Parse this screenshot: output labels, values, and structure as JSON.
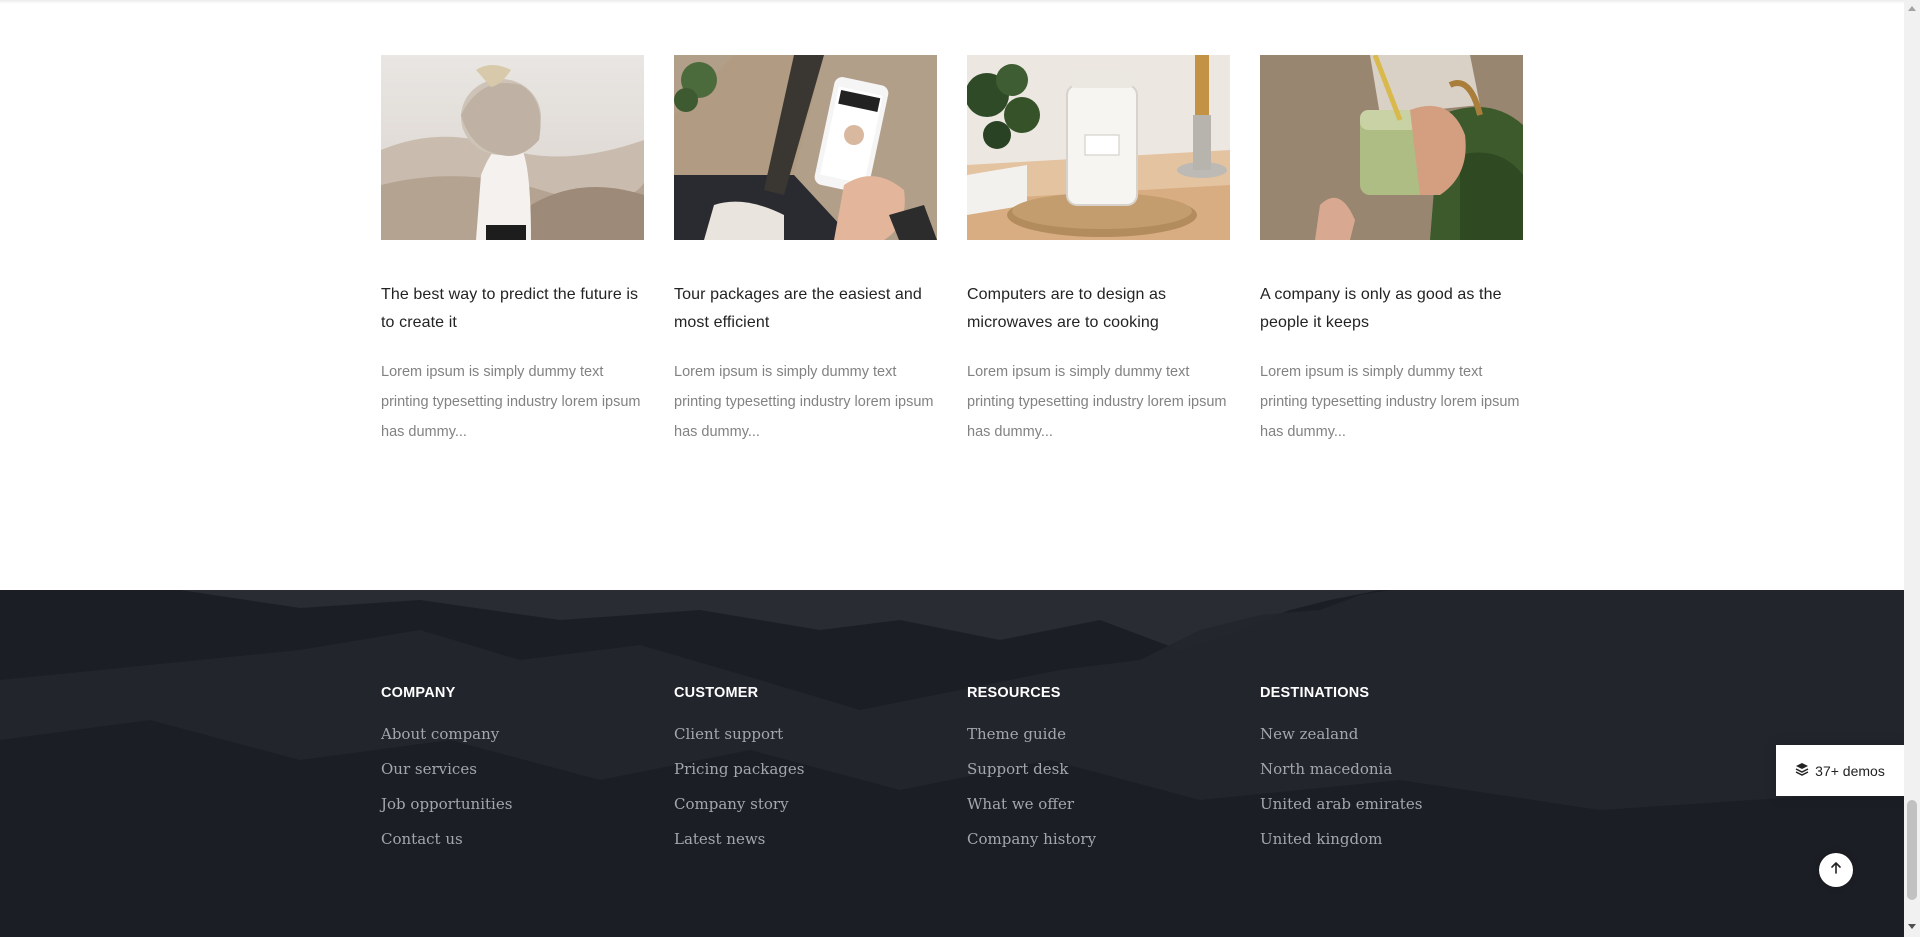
{
  "blog": {
    "posts": [
      {
        "image": "woman-desert-sweater-photo",
        "title": "The best way to predict the future is to create it",
        "excerpt": "Lorem ipsum is simply dummy text printing typesetting industry lorem ipsum has dummy..."
      },
      {
        "image": "phone-in-hand-photo",
        "title": "Tour packages are the easiest and most efficient",
        "excerpt": "Lorem ipsum is simply dummy text printing typesetting industry lorem ipsum has dummy..."
      },
      {
        "image": "candle-jar-plant-photo",
        "title": "Computers are to design as microwaves are to cooking",
        "excerpt": "Lorem ipsum is simply dummy text printing typesetting industry lorem ipsum has dummy..."
      },
      {
        "image": "green-smoothie-photo",
        "title": "A company is only as good as the people it keeps",
        "excerpt": "Lorem ipsum is simply dummy text printing typesetting industry lorem ipsum has dummy..."
      }
    ]
  },
  "footer": {
    "columns": [
      {
        "heading": "Company",
        "links": [
          "About company",
          "Our services",
          "Job opportunities",
          "Contact us"
        ]
      },
      {
        "heading": "Customer",
        "links": [
          "Client support",
          "Pricing packages",
          "Company story",
          "Latest news"
        ]
      },
      {
        "heading": "Resources",
        "links": [
          "Theme guide",
          "Support desk",
          "What we offer",
          "Company history"
        ]
      },
      {
        "heading": "Destinations",
        "links": [
          "New zealand",
          "North macedonia",
          "United arab emirates",
          "United kingdom"
        ]
      }
    ]
  },
  "widgets": {
    "demos_label": "37+ demos",
    "demos_icon": "layers-icon",
    "scroll_top_icon": "arrow-up-icon"
  },
  "colors": {
    "footer_bg": "#1c1e25",
    "footer_link": "#a4a6ad",
    "title": "#232323",
    "excerpt": "#828282"
  }
}
